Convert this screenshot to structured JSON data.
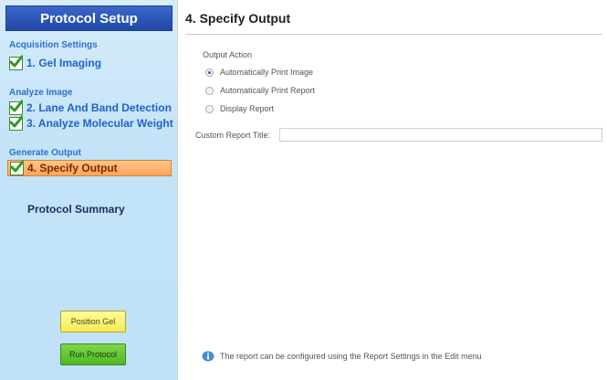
{
  "sidebar": {
    "header": "Protocol Setup",
    "sections": [
      {
        "label": "Acquisition Settings"
      },
      {
        "label": "Analyze Image"
      },
      {
        "label": "Generate Output"
      }
    ],
    "steps": [
      {
        "label": "1. Gel Imaging"
      },
      {
        "label": "2. Lane And Band Detection"
      },
      {
        "label": "3. Analyze Molecular Weight"
      },
      {
        "label": "4. Specify Output"
      }
    ],
    "summary": "Protocol Summary",
    "position_gel": "Position Gel",
    "run_protocol": "Run Protocol"
  },
  "main": {
    "title": "4. Specify Output",
    "output_action_label": "Output Action",
    "options": [
      {
        "label": "Automatically Print Image",
        "selected": true
      },
      {
        "label": "Automatically Print Report",
        "selected": false
      },
      {
        "label": "Display Report",
        "selected": false
      }
    ],
    "custom_title_label": "Custom Report Title:",
    "custom_title_value": "",
    "info_text": "The report can be configured using the Report Settings in the Edit menu"
  }
}
